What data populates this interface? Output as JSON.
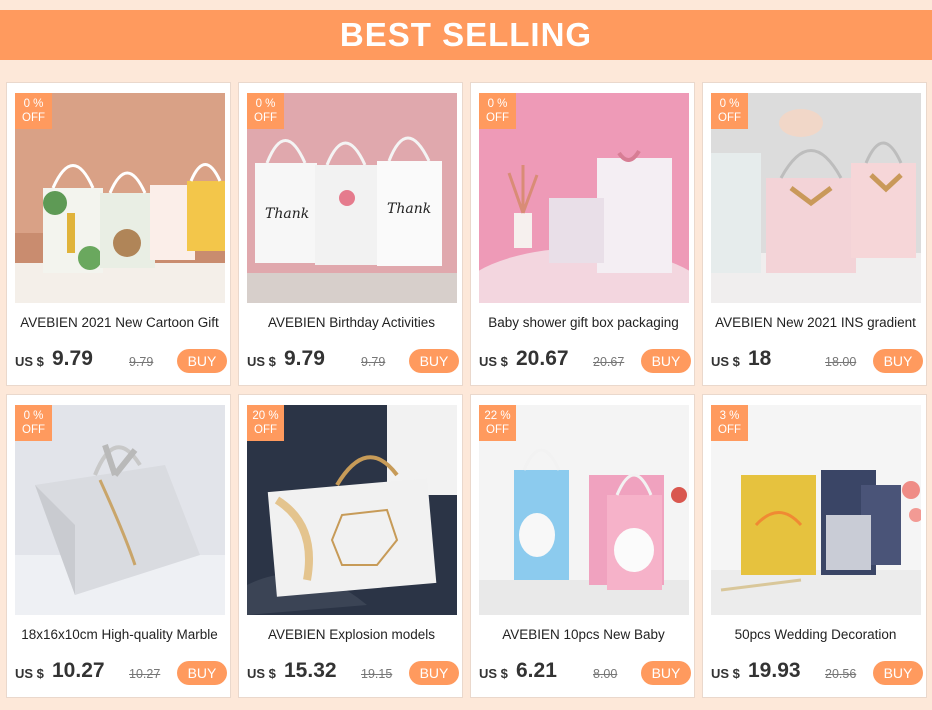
{
  "banner": {
    "title": "BEST SELLING"
  },
  "products": [
    {
      "title": "AVEBIEN 2021 New Cartoon Gift",
      "currency": "US $",
      "price": "9.79",
      "old_price": "9.79",
      "discount": "0 %",
      "off": "OFF",
      "buy": "BUY",
      "image": "cartoon-gift-bags"
    },
    {
      "title": "AVEBIEN Birthday Activities",
      "currency": "US $",
      "price": "9.79",
      "old_price": "9.79",
      "discount": "0 %",
      "off": "OFF",
      "buy": "BUY",
      "image": "thank-you-bags"
    },
    {
      "title": "Baby shower gift box packaging",
      "currency": "US $",
      "price": "20.67",
      "old_price": "20.67",
      "discount": "0 %",
      "off": "OFF",
      "buy": "BUY",
      "image": "pink-marble-boxes"
    },
    {
      "title": "AVEBIEN New 2021 INS gradient",
      "currency": "US $",
      "price": "18",
      "old_price": "18.00",
      "discount": "0 %",
      "off": "OFF",
      "buy": "BUY",
      "image": "gradient-ribbon-bags"
    },
    {
      "title": "18x16x10cm High-quality Marble",
      "currency": "US $",
      "price": "10.27",
      "old_price": "10.27",
      "discount": "0 %",
      "off": "OFF",
      "buy": "BUY",
      "image": "marble-bag"
    },
    {
      "title": "AVEBIEN Explosion models",
      "currency": "US $",
      "price": "15.32",
      "old_price": "19.15",
      "discount": "20 %",
      "off": "OFF",
      "buy": "BUY",
      "image": "specially-bag"
    },
    {
      "title": "AVEBIEN 10pcs New Baby",
      "currency": "US $",
      "price": "6.21",
      "old_price": "8.00",
      "discount": "22 %",
      "off": "OFF",
      "buy": "BUY",
      "image": "baby-bags"
    },
    {
      "title": "50pcs Wedding Decoration",
      "currency": "US $",
      "price": "19.93",
      "old_price": "20.56",
      "discount": "3 %",
      "off": "OFF",
      "buy": "BUY",
      "image": "glitter-bags"
    }
  ]
}
